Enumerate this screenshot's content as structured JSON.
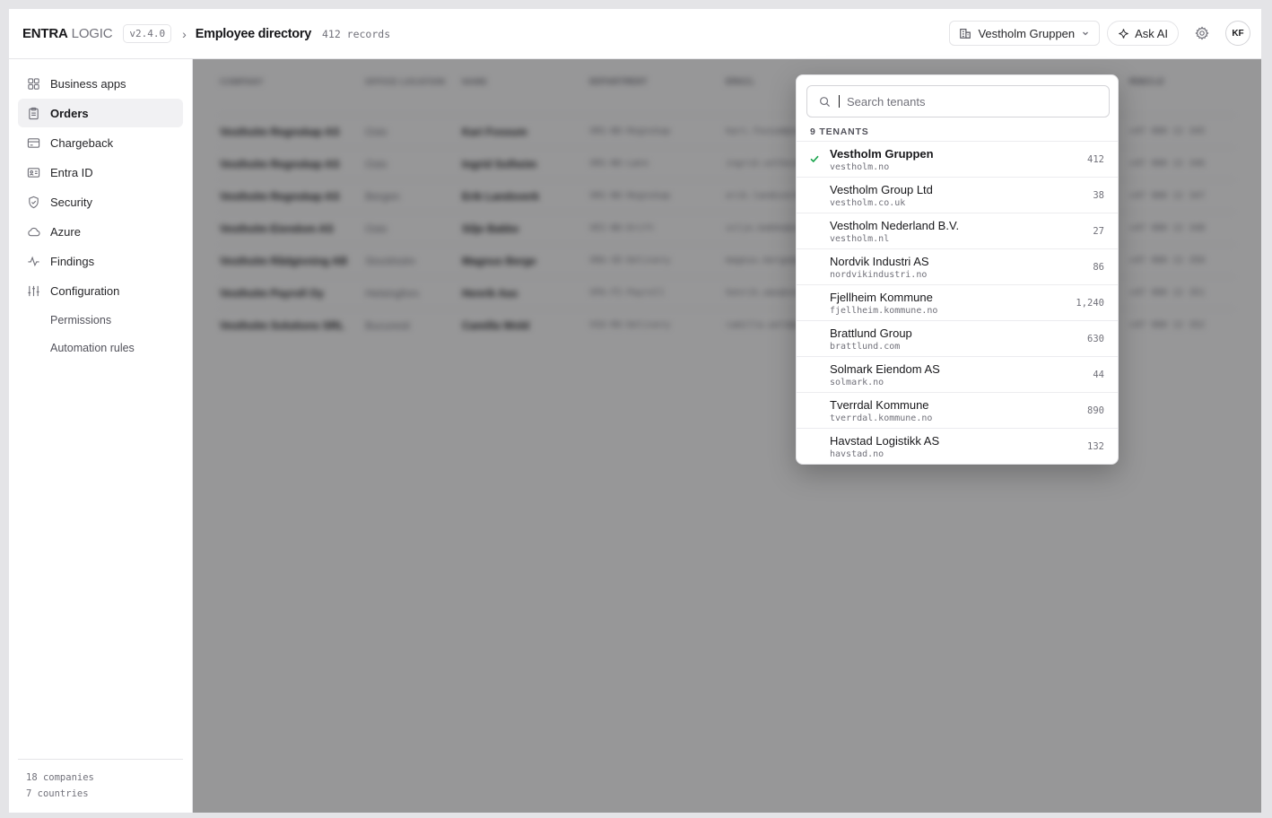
{
  "header": {
    "logo_part1": "ENTRA",
    "logo_part2": "LOGIC",
    "version": "v2.4.0",
    "breadcrumb_sep": "›",
    "page_title": "Employee directory",
    "records": "412 records",
    "tenant_selector": "Vestholm Gruppen",
    "ask_ai": "Ask AI",
    "avatar_initials": "KF"
  },
  "sidebar": {
    "items": [
      {
        "label": "Business apps",
        "icon": "grid-icon"
      },
      {
        "label": "Orders",
        "icon": "clipboard-icon",
        "active": true
      },
      {
        "label": "Chargeback",
        "icon": "credit-card-icon"
      },
      {
        "label": "Entra ID",
        "icon": "id-card-icon"
      },
      {
        "label": "Security",
        "icon": "shield-icon"
      },
      {
        "label": "Azure",
        "icon": "cloud-icon"
      },
      {
        "label": "Findings",
        "icon": "activity-icon"
      },
      {
        "label": "Configuration",
        "icon": "sliders-icon"
      }
    ],
    "sub_items": [
      {
        "label": "Permissions"
      },
      {
        "label": "Automation rules"
      }
    ],
    "footer": {
      "companies": "18 companies",
      "countries": "7 countries"
    }
  },
  "table": {
    "columns": [
      "Company",
      "Office location",
      "Name",
      "Department",
      "Email",
      "Mobile"
    ],
    "rows": [
      [
        "Vestholm Regnskap AS",
        "Oslo",
        "Kari Fossum",
        "VRS-NO-Regnskap",
        "kari.fossum@vestholm.no",
        "+47 900 12 345"
      ],
      [
        "Vestholm Regnskap AS",
        "Oslo",
        "Ingrid Solheim",
        "VRS-NO-Lønn",
        "ingrid.solheim@vestholm.no",
        "+47 900 12 346"
      ],
      [
        "Vestholm Regnskap AS",
        "Bergen",
        "Erik Landsverk",
        "VRS-NO-Regnskap",
        "erik.landsverk@vestholm.no",
        "+47 900 12 347"
      ],
      [
        "Vestholm Eiendom AS",
        "Oslo",
        "Silje Bakke",
        "VEI-NO-Drift",
        "silje.bakke@vestholm.no",
        "+47 900 12 348"
      ],
      [
        "Vestholm Rådgivning AB",
        "Stockholm",
        "Magnus Berge",
        "VRA-SE-Delivery",
        "magnus.berge@vestholm.se",
        "+47 900 12 350"
      ],
      [
        "Vestholm Payroll Oy",
        "Helsingfors",
        "Henrik Aas",
        "VPA-FI-Payroll",
        "henrik.aas@vestholm.fi",
        "+47 900 12 351"
      ],
      [
        "Vestholm Solutions SRL",
        "Bucuresti",
        "Camilla Wold",
        "VSO-RO-Delivery",
        "camilla.wold@vestholm.ro",
        "+47 900 12 352"
      ]
    ]
  },
  "dropdown": {
    "search_placeholder": "Search tenants",
    "count_label": "9 TENANTS",
    "tenants": [
      {
        "name": "Vestholm Gruppen",
        "domain": "vestholm.no",
        "count": "412",
        "selected": true
      },
      {
        "name": "Vestholm Group Ltd",
        "domain": "vestholm.co.uk",
        "count": "38"
      },
      {
        "name": "Vestholm Nederland B.V.",
        "domain": "vestholm.nl",
        "count": "27"
      },
      {
        "name": "Nordvik Industri AS",
        "domain": "nordvikindustri.no",
        "count": "86"
      },
      {
        "name": "Fjellheim Kommune",
        "domain": "fjellheim.kommune.no",
        "count": "1,240"
      },
      {
        "name": "Brattlund Group",
        "domain": "brattlund.com",
        "count": "630"
      },
      {
        "name": "Solmark Eiendom AS",
        "domain": "solmark.no",
        "count": "44"
      },
      {
        "name": "Tverrdal Kommune",
        "domain": "tverrdal.kommune.no",
        "count": "890"
      },
      {
        "name": "Havstad Logistikk AS",
        "domain": "havstad.no",
        "count": "132"
      }
    ]
  }
}
